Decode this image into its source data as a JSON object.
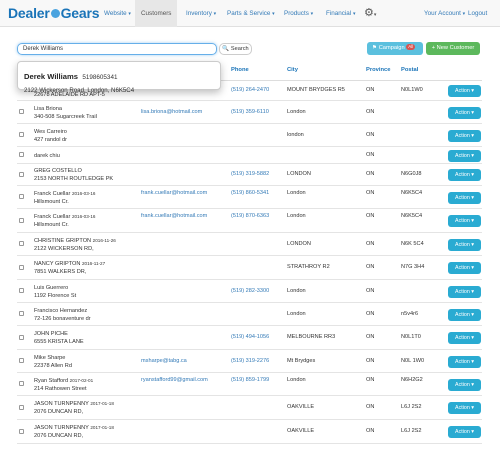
{
  "brand": {
    "part1": "Dealer",
    "part2": "Gears"
  },
  "nav": {
    "website": "Website",
    "customers": "Customers",
    "inventory": "Inventory",
    "parts_service": "Parts & Service",
    "products": "Products",
    "financial": "Financial",
    "account": "Your Account",
    "logout": "Logout"
  },
  "search": {
    "value": "Derek Williams",
    "button": "Search"
  },
  "actions": {
    "campaign": "Campaign",
    "campaign_badge": "All",
    "new_customer": "+ New Customer"
  },
  "popup": {
    "name": "Derek Williams",
    "phone": "5198605341",
    "address": "2122 Wickerson Road, London, N6K5C4"
  },
  "columns": {
    "phone": "Phone",
    "city": "City",
    "province": "Province",
    "postal": "Postal"
  },
  "action_label": "Action",
  "rows": [
    {
      "name": "",
      "date": "",
      "address": "22678 ADELAIDE RD APT-5",
      "email": "",
      "phone": "(519) 264-2470",
      "city": "MOUNT BRYDGES R5",
      "province": "ON",
      "postal": "N0L1W0"
    },
    {
      "name": "Lisa Briona",
      "date": "",
      "address": "340-508 Sugarcreek Trail",
      "email": "lisa.briona@hotmail.com",
      "phone": "(519) 359-6110",
      "city": "London",
      "province": "ON",
      "postal": ""
    },
    {
      "name": "Wes Carreiro",
      "date": "",
      "address": "427 randol dr",
      "email": "",
      "phone": "",
      "city": "london",
      "province": "ON",
      "postal": ""
    },
    {
      "name": "darek chiu",
      "date": "",
      "address": "",
      "email": "",
      "phone": "",
      "city": "",
      "province": "ON",
      "postal": ""
    },
    {
      "name": "GREG COSTELLO",
      "date": "",
      "address": "2153 NORTH ROUTLEDGE PK",
      "email": "",
      "phone": "(519) 319-5882",
      "city": "LONDON",
      "province": "ON",
      "postal": "N6G0J8"
    },
    {
      "name": "Franck Cuellar",
      "date": "2016-03-16",
      "address": "Hillsmount Cr.",
      "email": "frank.cuellar@hotmail.com",
      "phone": "(519) 860-5341",
      "city": "London",
      "province": "ON",
      "postal": "N6K5C4"
    },
    {
      "name": "Franck Cuellar",
      "date": "2016-03-16",
      "address": "Hillsmount Cr.",
      "email": "frank.cuellar@hotmail.com",
      "phone": "(519) 870-6363",
      "city": "London",
      "province": "ON",
      "postal": "N6K5C4"
    },
    {
      "name": "CHRISTINE GRIPTON",
      "date": "2016-11-26",
      "address": "2122 WICKERSON RD,",
      "email": "",
      "phone": "",
      "city": "LONDON",
      "province": "ON",
      "postal": "N6K 5C4"
    },
    {
      "name": "NANCY GRIPTON",
      "date": "2016-11-27",
      "address": "7851 WALKERS DR,",
      "email": "",
      "phone": "",
      "city": "STRATHROY R2",
      "province": "ON",
      "postal": "N7G 3H4"
    },
    {
      "name": "Luis Guerrero",
      "date": "",
      "address": "1192 Florence St",
      "email": "",
      "phone": "(519) 282-3300",
      "city": "London",
      "province": "ON",
      "postal": ""
    },
    {
      "name": "Francisco Hernandez",
      "date": "",
      "address": "72-126 bonaventure dr",
      "email": "",
      "phone": "",
      "city": "London",
      "province": "ON",
      "postal": "n5v4r6"
    },
    {
      "name": "JOHN PICHE",
      "date": "",
      "address": "6555 KRISTA LANE",
      "email": "",
      "phone": "(519) 494-1056",
      "city": "MELBOURNE RR3",
      "province": "ON",
      "postal": "N0L1T0"
    },
    {
      "name": "Mike Sharpe",
      "date": "",
      "address": "22378 Allen Rd",
      "email": "msharpe@tabg.ca",
      "phone": "(519) 319-2276",
      "city": "Mt Brydges",
      "province": "ON",
      "postal": "N0L 1W0"
    },
    {
      "name": "Ryan Stafford",
      "date": "2017-02-01",
      "address": "214 Rathowen Street",
      "email": "ryanstafford99@gmail.com",
      "phone": "(519) 859-1799",
      "city": "London",
      "province": "ON",
      "postal": "N6H2G2"
    },
    {
      "name": "JASON TURNPENNY",
      "date": "2017-01-18",
      "address": "2076 DUNCAN RD,",
      "email": "",
      "phone": "",
      "city": "OAKVILLE",
      "province": "ON",
      "postal": "L6J 2S2"
    },
    {
      "name": "JASON TURNPENNY",
      "date": "2017-01-18",
      "address": "2076 DUNCAN RD,",
      "email": "",
      "phone": "",
      "city": "OAKVILLE",
      "province": "ON",
      "postal": "L6J 2S2"
    }
  ]
}
